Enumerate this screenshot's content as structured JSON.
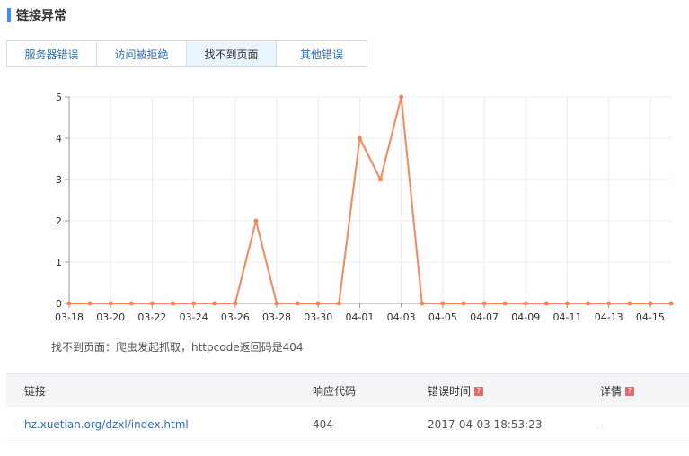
{
  "section": {
    "title": "链接异常"
  },
  "tabs": [
    {
      "label": "服务器错误",
      "active": false
    },
    {
      "label": "访问被拒绝",
      "active": false
    },
    {
      "label": "找不到页面",
      "active": true
    },
    {
      "label": "其他错误",
      "active": false
    }
  ],
  "chart_data": {
    "type": "line",
    "x": [
      "03-18",
      "03-19",
      "03-20",
      "03-21",
      "03-22",
      "03-23",
      "03-24",
      "03-25",
      "03-26",
      "03-27",
      "03-28",
      "03-29",
      "03-30",
      "03-31",
      "04-01",
      "04-02",
      "04-03",
      "04-04",
      "04-05",
      "04-06",
      "04-07",
      "04-08",
      "04-09",
      "04-10",
      "04-11",
      "04-12",
      "04-13",
      "04-14",
      "04-15",
      "04-16"
    ],
    "tick_labels": [
      "03-18",
      "03-20",
      "03-22",
      "03-24",
      "03-26",
      "03-28",
      "03-30",
      "04-01",
      "04-03",
      "04-05",
      "04-07",
      "04-09",
      "04-11",
      "04-13",
      "04-15"
    ],
    "series": [
      {
        "values": [
          0,
          0,
          0,
          0,
          0,
          0,
          0,
          0,
          0,
          2,
          0,
          0,
          0,
          0,
          4,
          3,
          5,
          0,
          0,
          0,
          0,
          0,
          0,
          0,
          0,
          0,
          0,
          0,
          0,
          0
        ]
      }
    ],
    "ylim": [
      0,
      5
    ],
    "yticks": [
      0,
      1,
      2,
      3,
      4,
      5
    ],
    "grid": true,
    "color": "#f4875b"
  },
  "note": "找不到页面：爬虫发起抓取，httpcode返回码是404",
  "table": {
    "headers": {
      "link": "链接",
      "code": "响应代码",
      "time": "错误时间",
      "detail": "详情"
    },
    "help_icon": "?",
    "rows": [
      {
        "link": "hz.xuetian.org/dzxl/index.html",
        "code": "404",
        "time": "2017-04-03 18:53:23",
        "detail": "-"
      }
    ]
  }
}
